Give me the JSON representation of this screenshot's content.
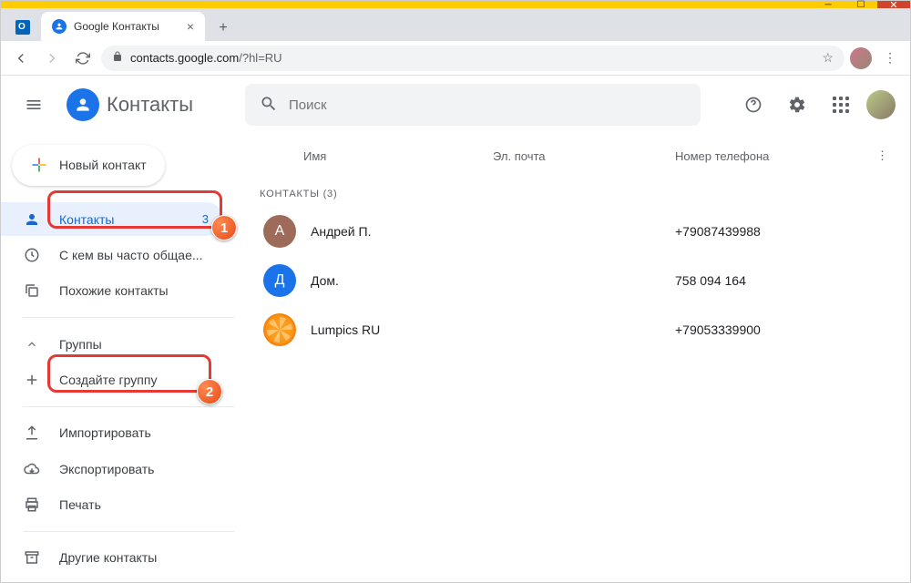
{
  "window": {
    "tab_title": "Google Контакты",
    "url_host": "contacts.google.com",
    "url_path": "/?hl=RU"
  },
  "header": {
    "app_name": "Контакты",
    "search_placeholder": "Поиск"
  },
  "sidebar": {
    "create_label": "Новый контакт",
    "items": {
      "contacts": {
        "label": "Контакты",
        "count": "3"
      },
      "frequent": {
        "label": "С кем вы часто общае..."
      },
      "merge": {
        "label": "Похожие контакты"
      },
      "groups": {
        "label": "Группы"
      },
      "create_group": {
        "label": "Создайте группу"
      },
      "import": {
        "label": "Импортировать"
      },
      "export": {
        "label": "Экспортировать"
      },
      "print": {
        "label": "Печать"
      },
      "other": {
        "label": "Другие контакты"
      }
    }
  },
  "list": {
    "cols": {
      "name": "Имя",
      "email": "Эл. почта",
      "phone": "Номер телефона"
    },
    "section_label": "КОНТАКТЫ (3)",
    "rows": [
      {
        "initial": "А",
        "name": "Андрей П.",
        "email": "",
        "phone": "+79087439988"
      },
      {
        "initial": "Д",
        "name": "Дом.",
        "email": "",
        "phone": "758 094 164"
      },
      {
        "initial": "",
        "name": "Lumpics RU",
        "email": "",
        "phone": "+79053339900"
      }
    ]
  },
  "annotations": {
    "step1": "1",
    "step2": "2"
  }
}
